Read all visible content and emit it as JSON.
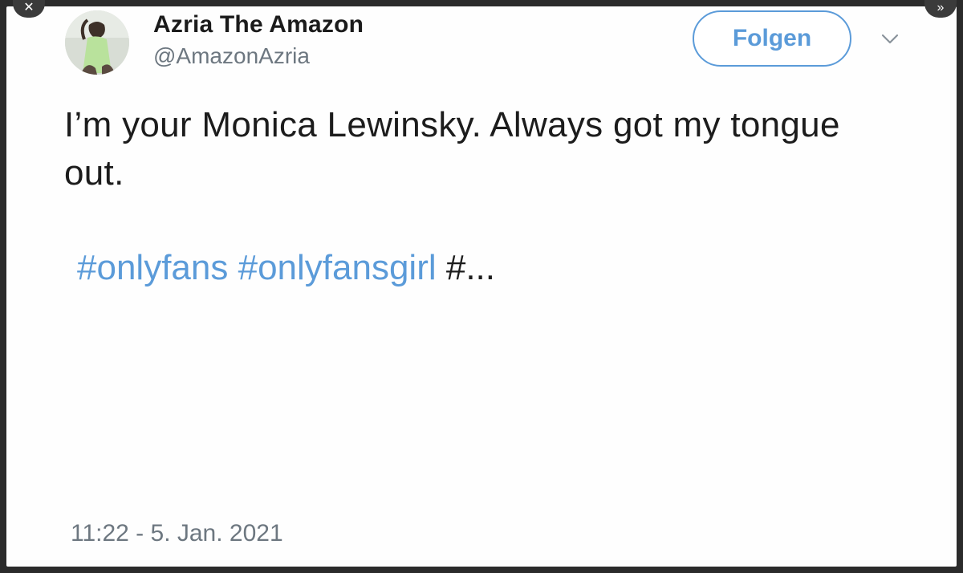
{
  "controls": {
    "close_icon": "✕",
    "more_icon": "»"
  },
  "tweet": {
    "display_name": "Azria The Amazon",
    "handle": "@AmazonAzria",
    "follow_label": "Folgen",
    "chevron_icon": "chevron-down-icon",
    "text": "I’m your Monica Lewinsky. Always got my tongue out.",
    "hashtags": [
      "#onlyfans",
      "#onlyfansgirl"
    ],
    "truncated_tail": "#...",
    "timestamp": "11:22 - 5. Jan. 2021"
  },
  "colors": {
    "link_blue": "#5b9bd9",
    "text_dark": "#1c1c1c",
    "text_muted": "#6d7780"
  }
}
